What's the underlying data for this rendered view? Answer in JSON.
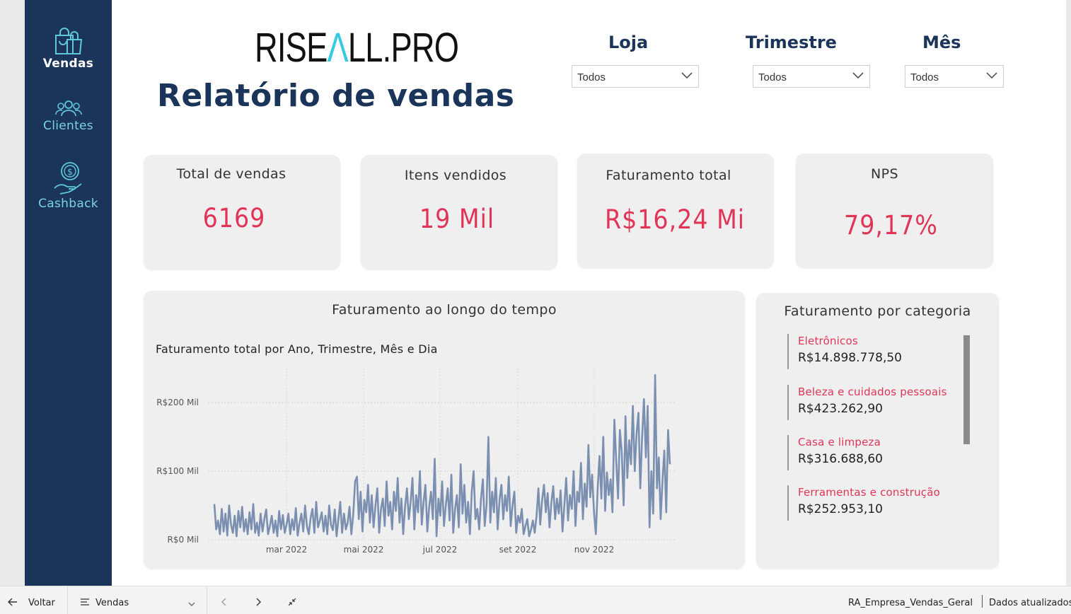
{
  "sidebar": {
    "items": [
      {
        "label": "Vendas",
        "icon": "shopping-bag-icon",
        "active": true
      },
      {
        "label": "Clientes",
        "icon": "users-icon",
        "active": false
      },
      {
        "label": "Cashback",
        "icon": "cashback-hand-icon",
        "active": false
      }
    ]
  },
  "header": {
    "logo_prefix": "RISE",
    "logo_accent": "Λ",
    "logo_suffix": "LL.PRO",
    "title": "Relatório de vendas"
  },
  "filters": [
    {
      "label": "Loja",
      "value": "Todos"
    },
    {
      "label": "Trimestre",
      "value": "Todos"
    },
    {
      "label": "Mês",
      "value": "Todos"
    }
  ],
  "kpis": [
    {
      "title": "Total de vendas",
      "value": "6169"
    },
    {
      "title": "Itens vendidos",
      "value": "19 Mil"
    },
    {
      "title": "Faturamento total",
      "value": "R$16,24 Mi"
    },
    {
      "title": "NPS",
      "value": "79,17%"
    }
  ],
  "timeline": {
    "card_title": "Faturamento ao longo do tempo",
    "subtitle": "Faturamento total por Ano, Trimestre, Mês e Dia"
  },
  "chart_data": {
    "type": "line",
    "title": "Faturamento total por Ano, Trimestre, Mês e Dia",
    "xlabel": "",
    "ylabel": "",
    "x_ticks": [
      "mar 2022",
      "mai 2022",
      "jul 2022",
      "set 2022",
      "nov 2022"
    ],
    "y_ticks": [
      "R$0 Mil",
      "R$100 Mil",
      "R$200 Mil"
    ],
    "ylim": [
      0,
      200
    ],
    "y_unit": "R$ Mil",
    "grid": true,
    "series": [
      {
        "values": [
          52,
          15,
          28,
          8,
          45,
          12,
          38,
          6,
          50,
          22,
          10,
          35,
          5,
          42,
          18,
          48,
          12,
          30,
          8,
          40,
          15,
          52,
          10,
          25,
          6,
          38,
          12,
          30,
          44,
          8,
          20,
          35,
          10,
          28,
          5,
          42,
          15,
          36,
          10,
          22,
          38,
          8,
          30,
          14,
          46,
          6,
          24,
          38,
          12,
          50,
          20,
          8,
          32,
          45,
          10,
          55,
          18,
          28,
          40,
          12,
          35,
          8,
          50,
          22,
          14,
          44,
          5,
          30,
          55,
          10,
          38,
          15,
          25,
          48,
          8,
          36,
          85,
          92,
          30,
          70,
          12,
          58,
          40,
          80,
          25,
          65,
          18,
          50,
          75,
          10,
          45,
          60,
          20,
          85,
          35,
          55,
          15,
          70,
          42,
          90,
          25,
          60,
          8,
          48,
          75,
          30,
          55,
          90,
          15,
          65,
          40,
          100,
          22,
          55,
          80,
          12,
          48,
          70,
          30,
          118,
          5,
          60,
          35,
          85,
          20,
          50,
          75,
          28,
          95,
          10,
          45,
          65,
          18,
          110,
          38,
          80,
          25,
          55,
          8,
          70,
          100,
          30,
          45,
          15,
          60,
          88,
          20,
          50,
          150,
          25,
          70,
          40,
          90,
          15,
          58,
          80,
          30,
          65,
          42,
          92,
          20,
          50,
          70,
          10,
          35,
          25,
          45,
          8,
          20,
          30,
          5,
          15,
          28,
          10,
          35,
          75,
          22,
          58,
          80,
          40,
          68,
          18,
          55,
          78,
          30,
          60,
          38,
          72,
          12,
          50,
          90,
          28,
          65,
          45,
          100,
          20,
          70,
          55,
          112,
          30,
          82,
          48,
          138,
          62,
          95,
          40,
          8,
          75,
          122,
          60,
          150,
          42,
          98,
          65,
          88,
          40,
          175,
          115,
          60,
          160,
          128,
          50,
          180,
          90,
          145,
          110,
          195,
          100,
          155,
          185,
          75,
          150,
          205,
          120,
          195,
          18,
          100,
          38,
          240,
          75,
          120,
          30,
          85,
          130,
          40,
          160,
          110
        ]
      }
    ]
  },
  "categories": {
    "title": "Faturamento por categoria",
    "items": [
      {
        "name": "Eletrônicos",
        "value": "R$14.898.778,50"
      },
      {
        "name": "Beleza e cuidados pessoais",
        "value": "R$423.262,90"
      },
      {
        "name": "Casa e limpeza",
        "value": "R$316.688,60"
      },
      {
        "name": "Ferramentas e construção",
        "value": "R$252.953,10"
      }
    ]
  },
  "bottombar": {
    "back_label": "Voltar",
    "page_label": "Vendas",
    "dataset": "RA_Empresa_Vendas_Geral",
    "status": "Dados atualizados"
  },
  "colors": {
    "sidebar": "#1b3459",
    "title": "#1b3459",
    "accent": "#e03556",
    "line": "#7b8fb0",
    "logo_accent": "#35c9e6"
  }
}
